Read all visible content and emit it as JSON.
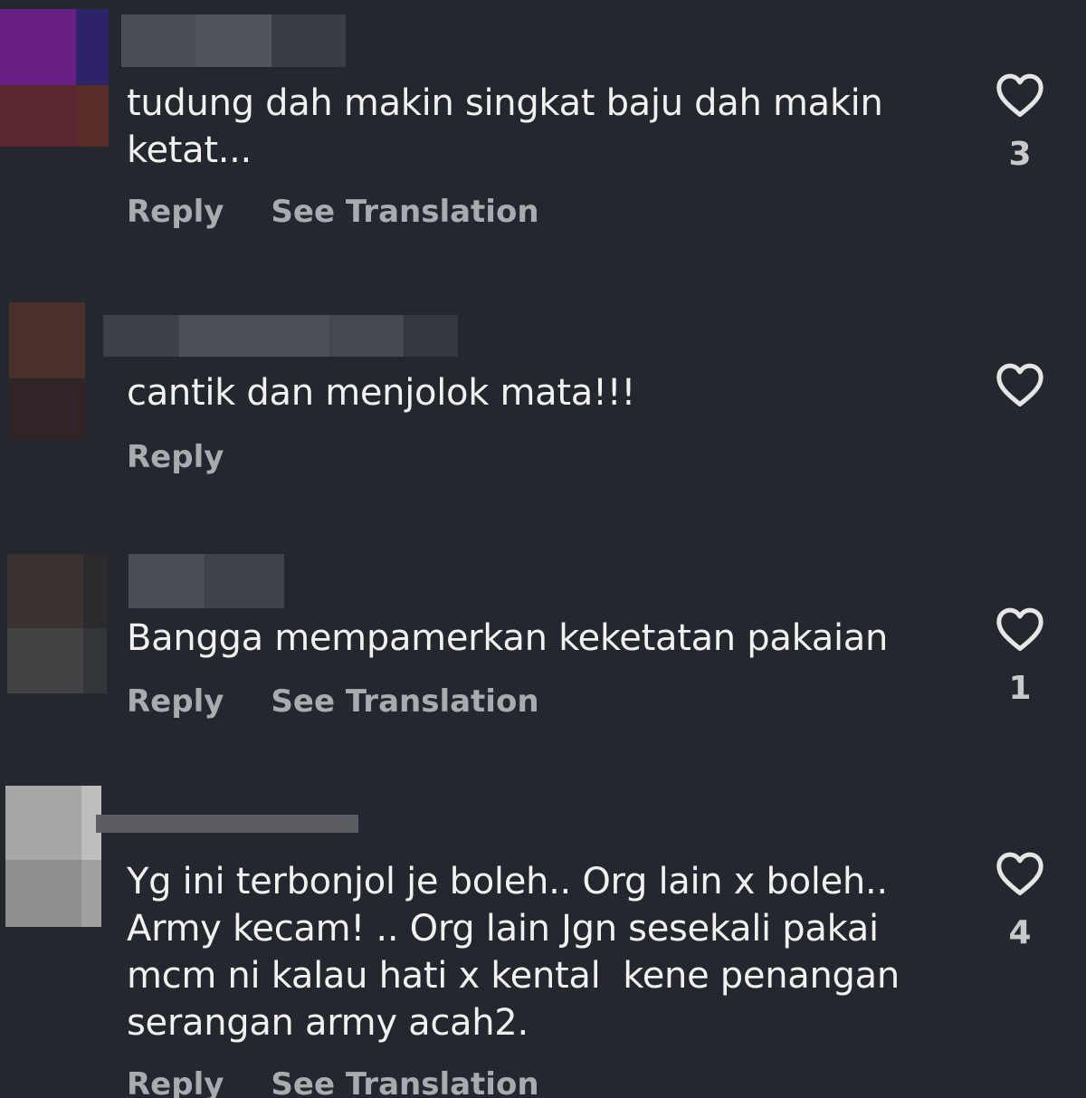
{
  "colors": {
    "background": "#25272e",
    "comment_text": "#f1f1f1",
    "action_text": "#a9abb0",
    "icon": "#e6e6e6"
  },
  "comments": [
    {
      "username": "",
      "text": "tudung dah makin singkat baju dah makin\nketat...",
      "reply_label": "Reply",
      "translate_label": "See Translation",
      "like_icon": "heart-outline-icon",
      "like_count": "3"
    },
    {
      "username": "",
      "text": "cantik dan menjolok mata!!!",
      "reply_label": "Reply",
      "translate_label": "",
      "like_icon": "heart-outline-icon",
      "like_count": ""
    },
    {
      "username": "",
      "text": "Bangga mempamerkan keketatan pakaian",
      "reply_label": "Reply",
      "translate_label": "See Translation",
      "like_icon": "heart-outline-icon",
      "like_count": "1"
    },
    {
      "username": "",
      "text": "Yg ini terbonjol je boleh.. Org lain x boleh..\nArmy kecam! .. Org lain Jgn sesekali pakai\nmcm ni kalau hati x kental  kene penangan\nserangan army acah2.",
      "reply_label": "Reply",
      "translate_label": "See Translation",
      "like_icon": "heart-outline-icon",
      "like_count": "4"
    }
  ]
}
